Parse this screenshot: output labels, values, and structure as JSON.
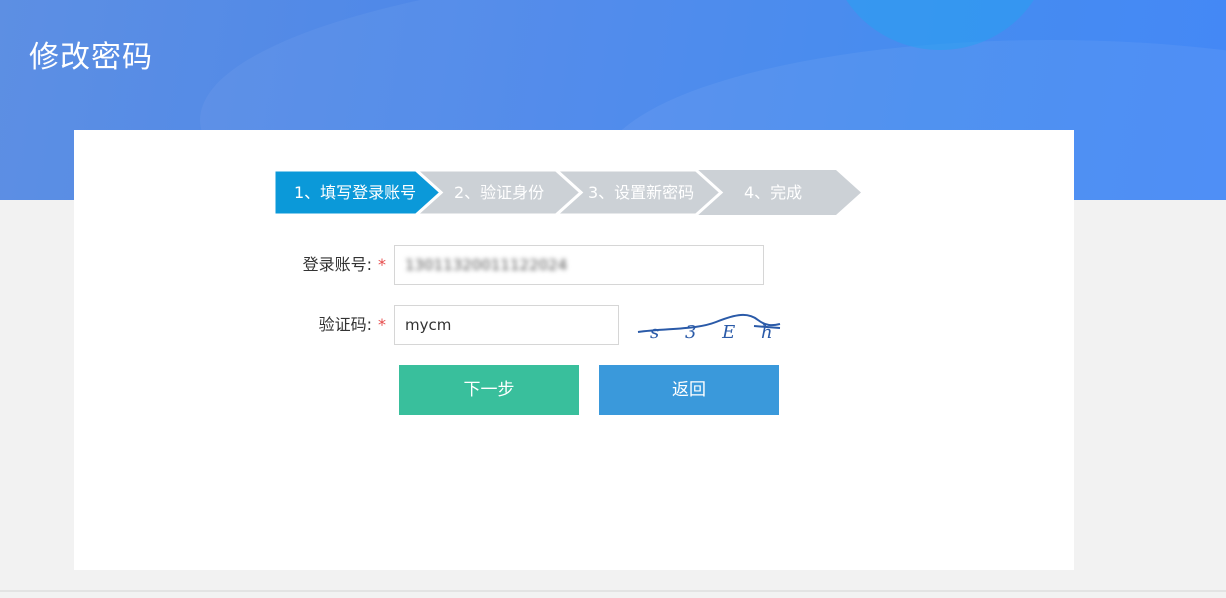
{
  "page": {
    "title": "修改密码"
  },
  "steps": [
    {
      "label": "1、填写登录账号",
      "active": true
    },
    {
      "label": "2、验证身份",
      "active": false
    },
    {
      "label": "3、设置新密码",
      "active": false
    },
    {
      "label": "4、完成",
      "active": false
    }
  ],
  "form": {
    "account": {
      "label": "登录账号:",
      "required_mark": "*",
      "value": "13011320011122024"
    },
    "captcha": {
      "label": "验证码:",
      "required_mark": "*",
      "value": "mycm",
      "image_text": "s 3 E h"
    }
  },
  "buttons": {
    "next_label": "下一步",
    "back_label": "返回"
  },
  "colors": {
    "step_active": "#0b99d9",
    "step_inactive": "#ccd1d6",
    "next_button": "#39bf9c",
    "back_button": "#3a99db",
    "required": "#e64a4a"
  }
}
